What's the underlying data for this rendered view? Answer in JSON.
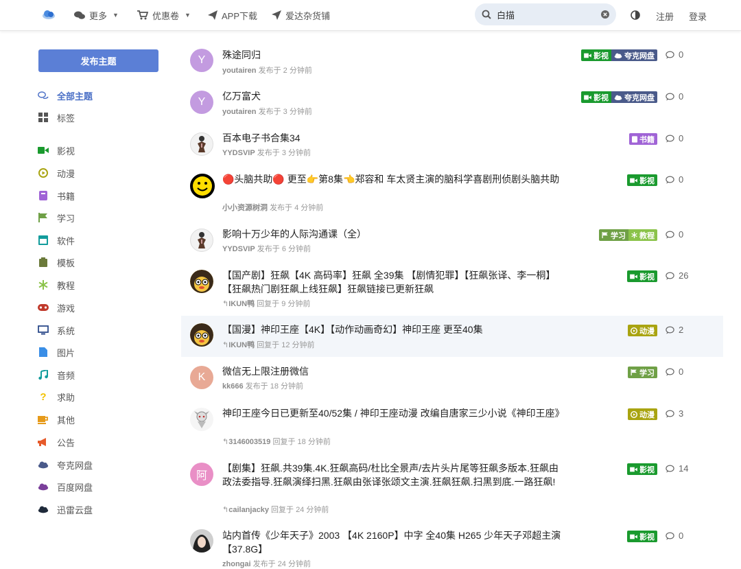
{
  "colors": {
    "accent": "#5b7fd6",
    "tag_video": "#1a9a2e",
    "tag_quark": "#4a5a8a",
    "tag_book": "#a064d6",
    "tag_study": "#6fa046",
    "tag_tutorial": "#8bc34a",
    "tag_anime": "#a9a411"
  },
  "header": {
    "nav": [
      {
        "label": "更多",
        "icon": "chat-bubbles-icon",
        "has_caret": true
      },
      {
        "label": "优惠卷",
        "icon": "cart-icon",
        "has_caret": true
      },
      {
        "label": "APP下载",
        "icon": "paper-plane-icon",
        "has_caret": false
      },
      {
        "label": "爱达杂货铺",
        "icon": "location-arrow-icon",
        "has_caret": false
      }
    ],
    "search": {
      "value": "白描",
      "placeholder": ""
    },
    "register": "注册",
    "login": "登录"
  },
  "sidebar": {
    "publish_label": "发布主题",
    "items": [
      {
        "label": "全部主题",
        "icon": "comments-icon",
        "active": true
      },
      {
        "label": "标签",
        "icon": "grid-icon"
      },
      {
        "label": "影视",
        "icon": "video-camera-icon"
      },
      {
        "label": "动漫",
        "icon": "play-circle-icon"
      },
      {
        "label": "书籍",
        "icon": "book-icon"
      },
      {
        "label": "学习",
        "icon": "flag-icon"
      },
      {
        "label": "软件",
        "icon": "window-icon"
      },
      {
        "label": "模板",
        "icon": "clipboard-icon"
      },
      {
        "label": "教程",
        "icon": "snowflake-icon"
      },
      {
        "label": "游戏",
        "icon": "gamepad-icon"
      },
      {
        "label": "系统",
        "icon": "monitor-icon"
      },
      {
        "label": "图片",
        "icon": "file-icon"
      },
      {
        "label": "音频",
        "icon": "music-icon"
      },
      {
        "label": "求助",
        "icon": "question-icon"
      },
      {
        "label": "其他",
        "icon": "mug-icon"
      },
      {
        "label": "公告",
        "icon": "megaphone-icon"
      },
      {
        "label": "夸克网盘",
        "icon": "cloud-icon"
      },
      {
        "label": "百度网盘",
        "icon": "cloud-icon"
      },
      {
        "label": "迅雷云盘",
        "icon": "cloud-icon"
      }
    ]
  },
  "topics": [
    {
      "title": "殊途同归",
      "author": "youtairen",
      "action": "发布于",
      "time": "2 分钟前",
      "replies": "0",
      "avatar_text": "Y",
      "avatar_color": "#c39be0",
      "tags": [
        {
          "label": "影视",
          "kind": "video"
        },
        {
          "label": "夸克网盘",
          "kind": "quark"
        }
      ]
    },
    {
      "title": "亿万富犬",
      "author": "youtairen",
      "action": "发布于",
      "time": "3 分钟前",
      "replies": "0",
      "avatar_text": "Y",
      "avatar_color": "#c39be0",
      "tags": [
        {
          "label": "影视",
          "kind": "video"
        },
        {
          "label": "夸克网盘",
          "kind": "quark"
        }
      ]
    },
    {
      "title": "百本电子书合集34",
      "author": "YYDSVIP",
      "action": "发布于",
      "time": "3 分钟前",
      "replies": "0",
      "avatar_text": "",
      "avatar_color": "#f2f2f2",
      "tags": [
        {
          "label": "书籍",
          "kind": "book"
        }
      ]
    },
    {
      "title": "🔴头脑共助🔴 更至👉第8集👈郑容和 车太贤主演的脑科学喜剧刑侦剧头脑共助",
      "author": "小小资源树洞",
      "action": "发布于",
      "time": "4 分钟前",
      "replies": "0",
      "avatar_text": "☺",
      "avatar_color": "#ffdd00",
      "tags": [
        {
          "label": "影视",
          "kind": "video"
        }
      ]
    },
    {
      "title": "影响十万少年的人际沟通课（全）",
      "author": "YYDSVIP",
      "action": "发布于",
      "time": "6 分钟前",
      "replies": "0",
      "avatar_text": "",
      "avatar_color": "#f2f2f2",
      "tags": [
        {
          "label": "学习",
          "kind": "study"
        },
        {
          "label": "教程",
          "kind": "tutorial"
        }
      ]
    },
    {
      "title": "【国产剧】狂飙【4K 高码率】狂飙 全39集 【剧情犯罪】【狂飙张译、李一桐】【狂飙热门剧狂飙上线狂飙】狂飙链接已更新狂飙",
      "author": "IKUN鸭",
      "action": "回复于",
      "time": "9 分钟前",
      "replies": "26",
      "avatar_text": "",
      "avatar_color": "#f4c542",
      "tags": [
        {
          "label": "影视",
          "kind": "video"
        }
      ]
    },
    {
      "title": "【国漫】神印王座【4K】【动作动画奇幻】神印王座 更至40集",
      "author": "IKUN鸭",
      "action": "回复于",
      "time": "12 分钟前",
      "replies": "2",
      "avatar_text": "",
      "avatar_color": "#f4c542",
      "tags": [
        {
          "label": "动漫",
          "kind": "anime"
        }
      ]
    },
    {
      "title": "微信无上限注册微信",
      "author": "kk666",
      "action": "发布于",
      "time": "18 分钟前",
      "replies": "0",
      "avatar_text": "K",
      "avatar_color": "#e8a995",
      "tags": [
        {
          "label": "学习",
          "kind": "study"
        }
      ]
    },
    {
      "title": "神印王座今日已更新至40/52集 / 神印王座动漫 改编自唐家三少小说《神印王座》",
      "author": "3146003519",
      "action": "回复于",
      "time": "18 分钟前",
      "replies": "3",
      "avatar_text": "",
      "avatar_color": "#f2f2f2",
      "tags": [
        {
          "label": "动漫",
          "kind": "anime"
        }
      ]
    },
    {
      "title": "【剧集】狂飙.共39集.4K.狂飙高码/杜比全景声/去片头片尾等狂飙多版本.狂飙由政法委指导.狂飙演绎扫黑.狂飙由张译张颂文主演.狂飙狂飙.扫黑到底.一路狂飙!",
      "author": "cailanjacky",
      "action": "回复于",
      "time": "24 分钟前",
      "replies": "14",
      "avatar_text": "阿",
      "avatar_color": "#e98fc6",
      "tags": [
        {
          "label": "影视",
          "kind": "video"
        }
      ]
    },
    {
      "title": "站内首传《少年天子》2003 【4K 2160P】中字 全40集 H265 少年天子邓超主演【37.8G】",
      "author": "zhongai",
      "action": "发布于",
      "time": "24 分钟前",
      "replies": "0",
      "avatar_text": "",
      "avatar_color": "#d8d8d8",
      "tags": [
        {
          "label": "影视",
          "kind": "video"
        }
      ]
    }
  ]
}
